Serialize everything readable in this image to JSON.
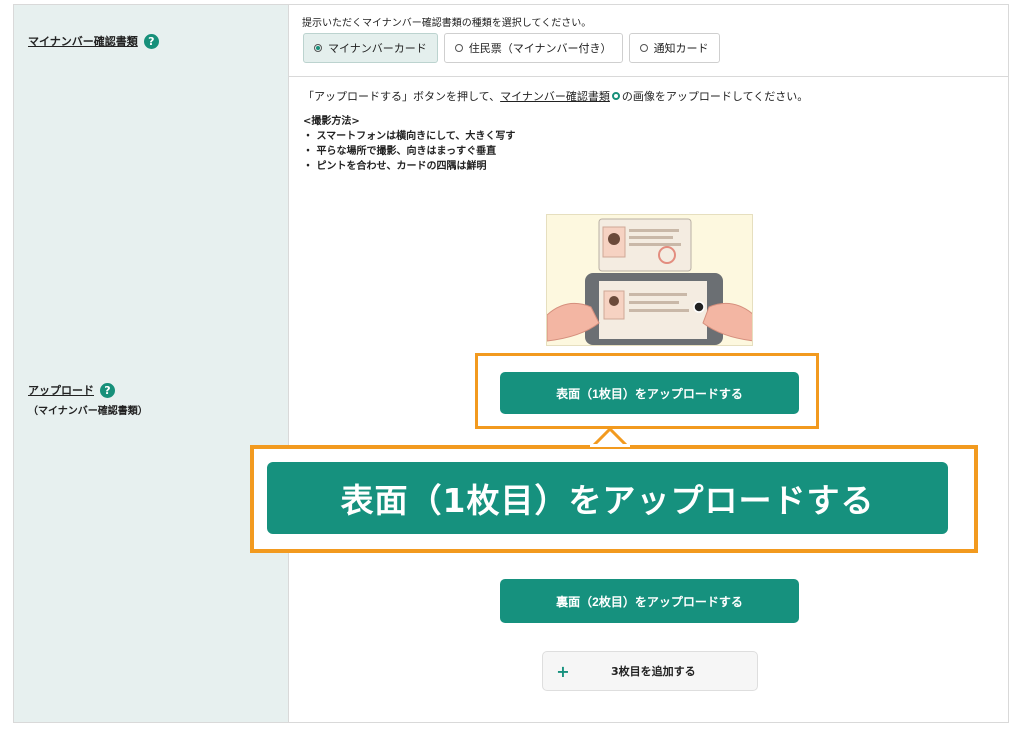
{
  "doc_type": {
    "label": "マイナンバー確認書類",
    "help": "?",
    "instruction": "提示いただくマイナンバー確認書類の種類を選択してください。",
    "options": [
      {
        "label": "マイナンバーカード",
        "selected": true
      },
      {
        "label": "住民票（マイナンバー付き）",
        "selected": false
      },
      {
        "label": "通知カード",
        "selected": false
      }
    ]
  },
  "upload": {
    "label": "アップロード",
    "help": "?",
    "sublabel": "（マイナンバー確認書類）",
    "desc_prefix": "「アップロードする」ボタンを押して、",
    "desc_link": "マイナンバー確認書類",
    "desc_suffix": "の画像をアップロードしてください。",
    "method_title": "<撮影方法>",
    "method_items": [
      "・ スマートフォンは横向きにして、大きく写す",
      "・ 平らな場所で撮影、向きはまっすぐ垂直",
      "・ ピントを合わせ、カードの四隅は鮮明"
    ],
    "front_button": "表面（1枚目）をアップロードする",
    "back_button": "裏面（2枚目）をアップロードする",
    "add_button_icon": "+",
    "add_button": "3枚目を追加する"
  },
  "callout": {
    "text": "表面（1枚目）をアップロードする"
  },
  "colors": {
    "accent": "#16917e",
    "highlight": "#f29a1f",
    "label_bg": "#e7f0ef"
  }
}
